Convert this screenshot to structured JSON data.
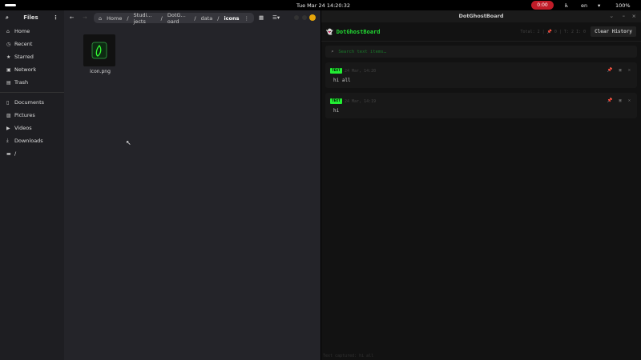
{
  "topbar": {
    "datetime": "Tue Mar 24 14:20:32",
    "recording": "0:00",
    "lang": "en",
    "battery": "100%"
  },
  "files": {
    "title": "Files",
    "sidebar": [
      {
        "label": "Home",
        "icon": "⌂"
      },
      {
        "label": "Recent",
        "icon": "◷"
      },
      {
        "label": "Starred",
        "icon": "★"
      },
      {
        "label": "Network",
        "icon": "▣"
      },
      {
        "label": "Trash",
        "icon": "▤"
      }
    ],
    "places": [
      {
        "label": "Documents",
        "icon": "▯"
      },
      {
        "label": "Pictures",
        "icon": "▨"
      },
      {
        "label": "Videos",
        "icon": "▶"
      },
      {
        "label": "Downloads",
        "icon": "⤓"
      },
      {
        "label": "/",
        "icon": "▬"
      }
    ],
    "breadcrumbs": [
      "Home",
      "Studi… jects",
      "DotG… oard",
      "data",
      "icons"
    ],
    "items": [
      {
        "name": "icon.png"
      }
    ]
  },
  "app": {
    "window_title": "DotGhostBoard",
    "brand": "DotGhostBoard",
    "stats": "Total: 2  |  📌 0  |  T: 2  I: 0",
    "clear_label": "Clear History",
    "search_placeholder": "Search text items…",
    "clips": [
      {
        "type": "TEXT",
        "time": "24 Mar, 14:20",
        "text": "hi all"
      },
      {
        "type": "TEXT",
        "time": "24 Mar, 14:19",
        "text": "hi"
      }
    ],
    "status": "Text captured: hi all"
  },
  "colors": {
    "accent": "#22dd33",
    "record": "#c01c28"
  }
}
